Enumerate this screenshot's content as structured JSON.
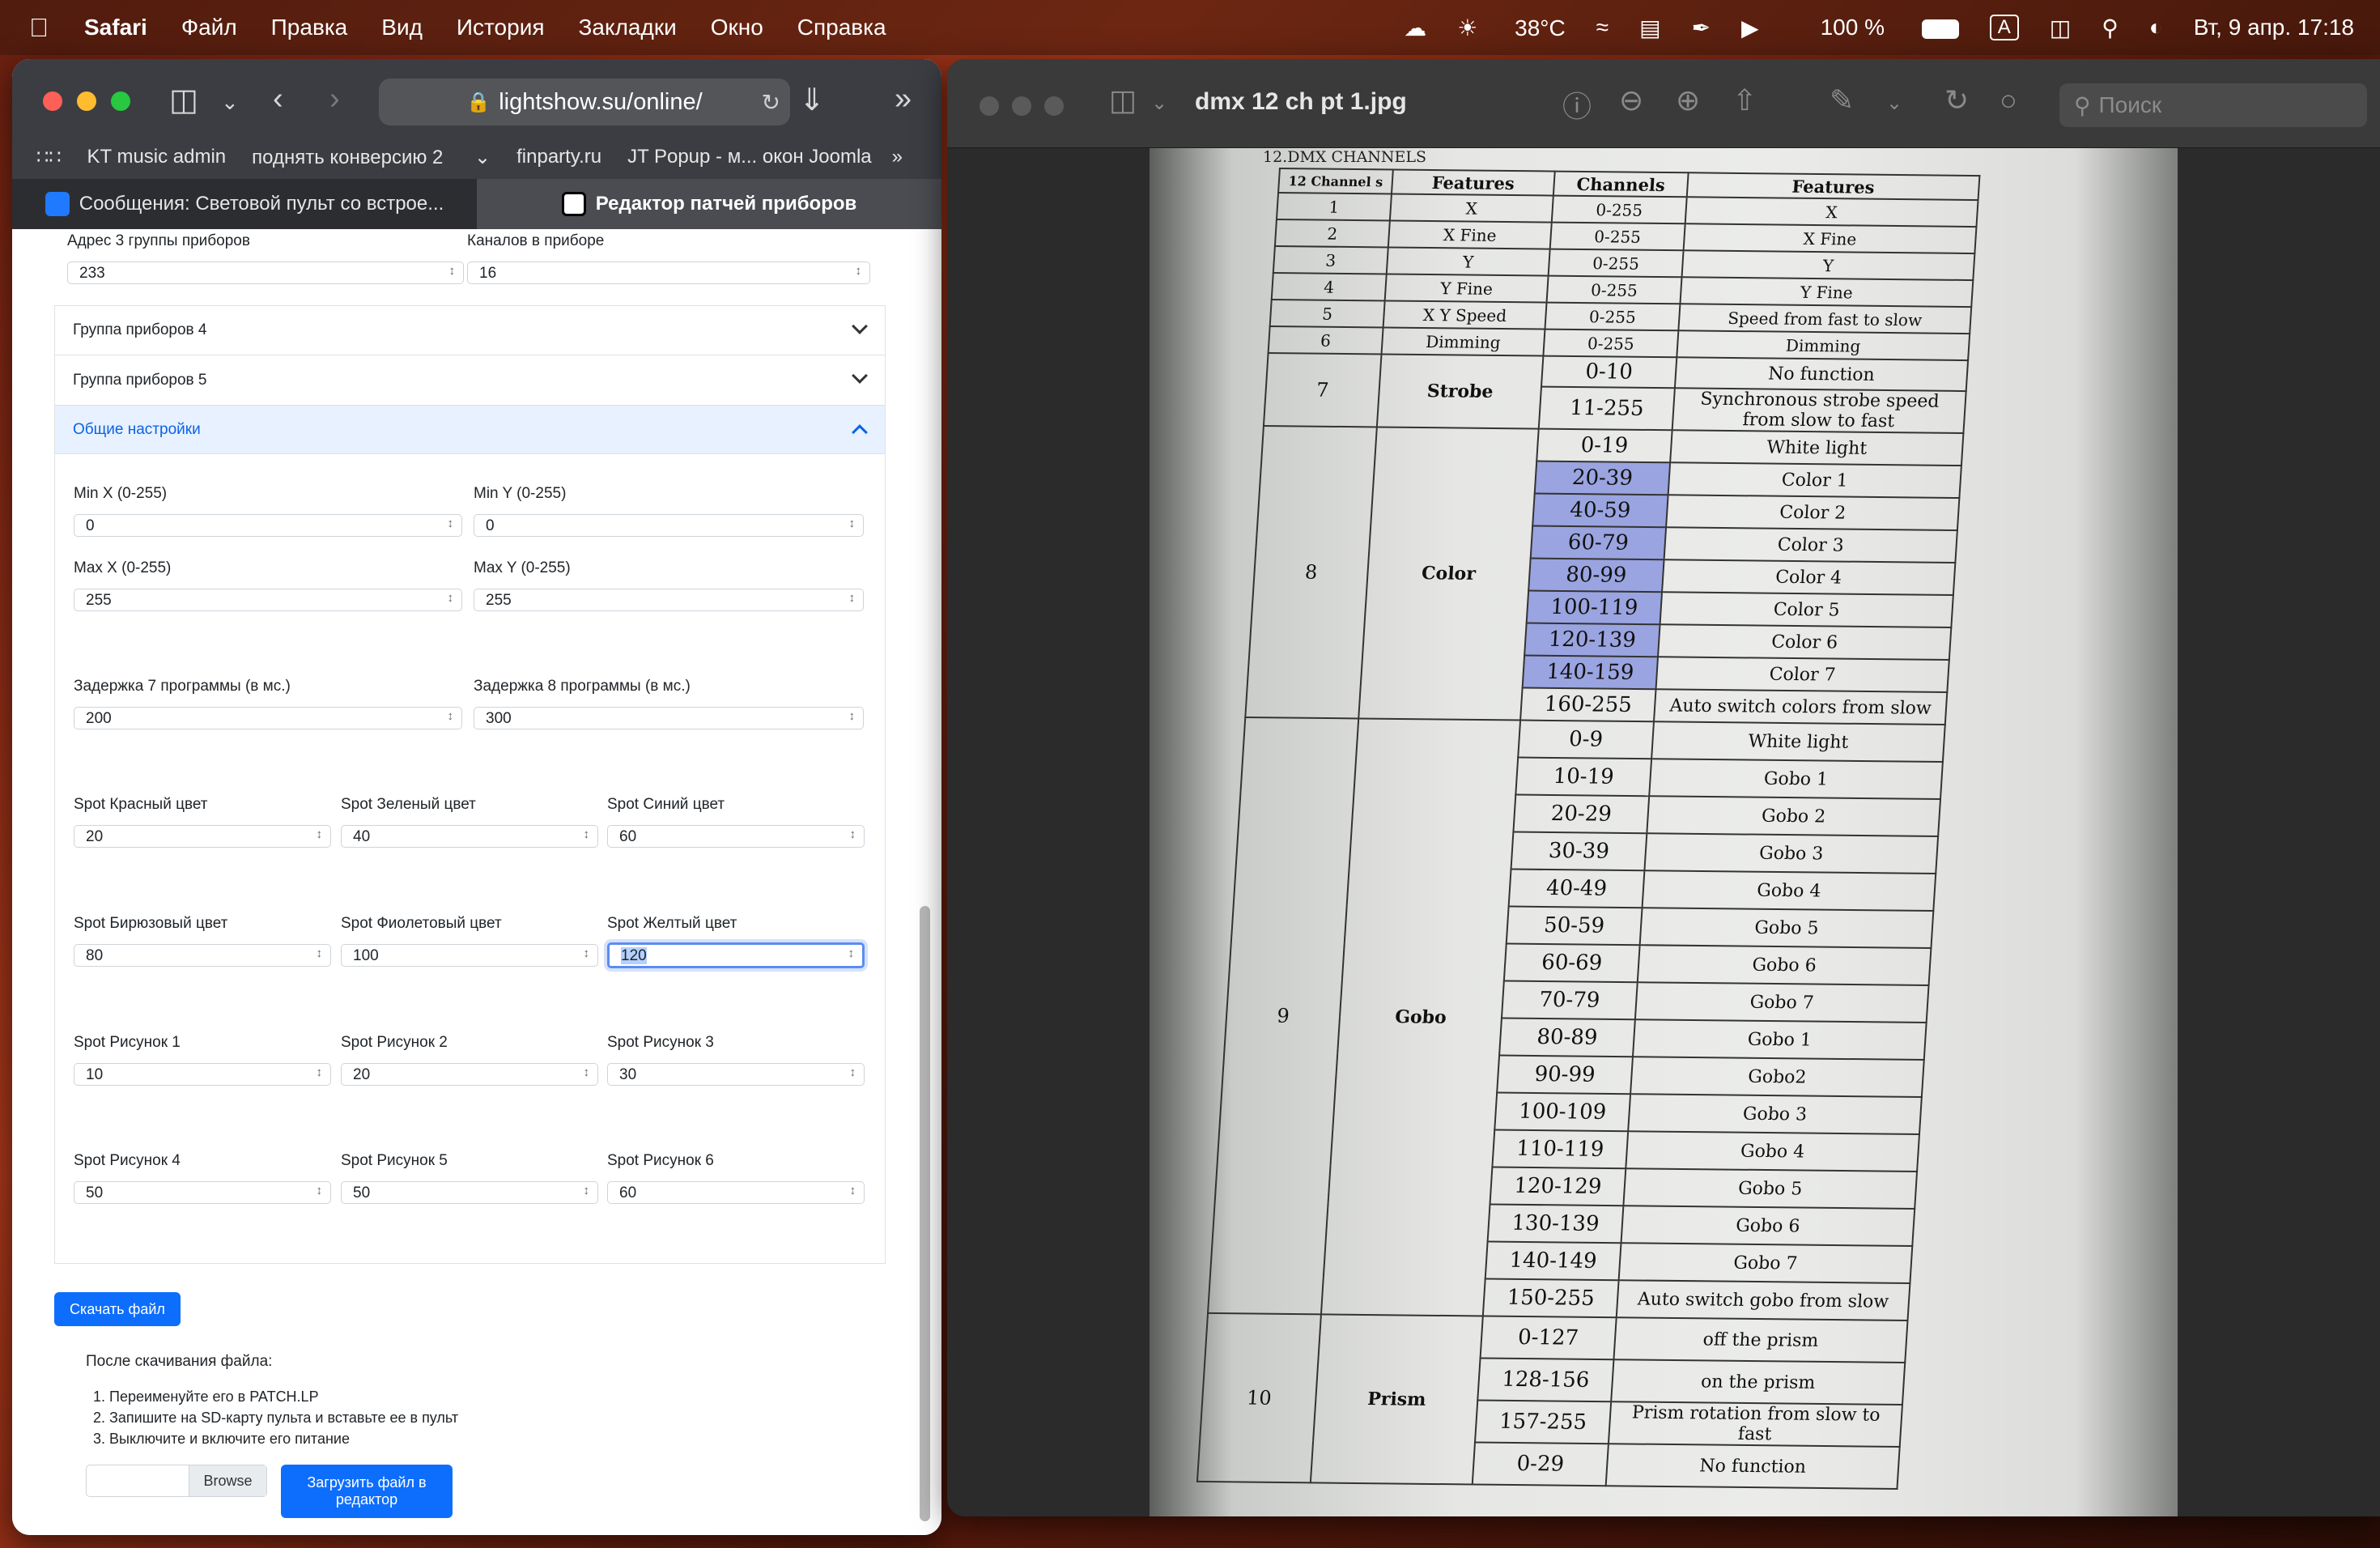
{
  "menubar": {
    "app": "Safari",
    "items": [
      "Файл",
      "Правка",
      "Вид",
      "История",
      "Закладки",
      "Окно",
      "Справка"
    ],
    "temperature": "38°C",
    "battery": "100 %",
    "input_lang": "A",
    "datetime": "Вт, 9 апр.  17:18"
  },
  "safari": {
    "url": "lightshow.su/online/",
    "bookmarks": [
      "KT music admin",
      "поднять конверсию 2",
      "finparty.ru",
      "JT Popup - м... окон Joomla"
    ],
    "tabs": [
      {
        "label": "Сообщения: Световой пульт со встрое...",
        "active": false
      },
      {
        "label": "Редактор патчей приборов",
        "active": true
      }
    ]
  },
  "form": {
    "group3_address_label": "Адрес 3 группы приборов",
    "group3_address": "233",
    "channels_label": "Каналов в приборе",
    "channels": "16",
    "group4": "Группа приборов 4",
    "group5": "Группа приборов 5",
    "general": "Общие настройки",
    "min_x_label": "Min X (0-255)",
    "min_x": "0",
    "min_y_label": "Min Y (0-255)",
    "min_y": "0",
    "max_x_label": "Max X (0-255)",
    "max_x": "255",
    "max_y_label": "Max Y (0-255)",
    "max_y": "255",
    "delay7_label": "Задержка 7 программы (в мс.)",
    "delay7": "200",
    "delay8_label": "Задержка 8 программы (в мс.)",
    "delay8": "300",
    "spot_colors": [
      {
        "label": "Spot Красный цвет",
        "value": "20"
      },
      {
        "label": "Spot Зеленый цвет",
        "value": "40"
      },
      {
        "label": "Spot Синий цвет",
        "value": "60"
      },
      {
        "label": "Spot Бирюзовый цвет",
        "value": "80"
      },
      {
        "label": "Spot Фиолетовый цвет",
        "value": "100"
      },
      {
        "label": "Spot Желтый цвет",
        "value": "120"
      }
    ],
    "spot_gobos": [
      {
        "label": "Spot Рисунок 1",
        "value": "10"
      },
      {
        "label": "Spot Рисунок 2",
        "value": "20"
      },
      {
        "label": "Spot Рисунок 3",
        "value": "30"
      },
      {
        "label": "Spot Рисунок 4",
        "value": "50"
      },
      {
        "label": "Spot Рисунок 5",
        "value": "50"
      },
      {
        "label": "Spot Рисунок 6",
        "value": "60"
      }
    ],
    "download_button": "Скачать файл",
    "after_download": "После скачивания файла:",
    "steps": [
      "1.  Переименуйте его в PATCH.LP",
      "2.  Запишите на SD-карту пульта и вставьте ее в пульт",
      "3.  Выключите и включите его питание"
    ],
    "browse": "Browse",
    "upload_button": "Загрузить файл в редактор"
  },
  "preview": {
    "title": "dmx 12 ch pt 1.jpg",
    "search_placeholder": "Поиск",
    "doc_title": "12.DMX CHANNELS",
    "headers": [
      "12 Channel s",
      "Features",
      "Channels",
      "Features"
    ],
    "rows": [
      {
        "ch": "1",
        "feat": "X",
        "val": "0-255",
        "desc": "X"
      },
      {
        "ch": "2",
        "feat": "X Fine",
        "val": "0-255",
        "desc": "X Fine"
      },
      {
        "ch": "3",
        "feat": "Y",
        "val": "0-255",
        "desc": "Y"
      },
      {
        "ch": "4",
        "feat": "Y  Fine",
        "val": "0-255",
        "desc": "Y Fine"
      },
      {
        "ch": "5",
        "feat": "X Y Speed",
        "val": "0-255",
        "desc": "Speed from fast to slow"
      },
      {
        "ch": "6",
        "feat": "Dimming",
        "val": "0-255",
        "desc": "Dimming"
      }
    ],
    "strobe": {
      "ch": "7",
      "feat": "Strobe",
      "rows": [
        {
          "val": "0-10",
          "desc": "No function"
        },
        {
          "val": "11-255",
          "desc": "Synchronous strobe speed from slow to fast"
        }
      ]
    },
    "color": {
      "ch": "8",
      "feat": "Color",
      "rows": [
        {
          "val": "0-19",
          "desc": "White light",
          "hl": false
        },
        {
          "val": "20-39",
          "desc": "Color 1",
          "hl": true
        },
        {
          "val": "40-59",
          "desc": "Color 2",
          "hl": true
        },
        {
          "val": "60-79",
          "desc": "Color 3",
          "hl": true
        },
        {
          "val": "80-99",
          "desc": "Color 4",
          "hl": true
        },
        {
          "val": "100-119",
          "desc": "Color 5",
          "hl": true
        },
        {
          "val": "120-139",
          "desc": "Color 6",
          "hl": true
        },
        {
          "val": "140-159",
          "desc": "Color 7",
          "hl": true
        },
        {
          "val": "160-255",
          "desc": "Auto switch colors   from slow",
          "hl": false
        }
      ]
    },
    "gobo": {
      "ch": "9",
      "feat": "Gobo",
      "rows": [
        {
          "val": "0-9",
          "desc": "White light"
        },
        {
          "val": "10-19",
          "desc": "Gobo 1"
        },
        {
          "val": "20-29",
          "desc": "Gobo 2"
        },
        {
          "val": "30-39",
          "desc": "Gobo 3"
        },
        {
          "val": "40-49",
          "desc": "Gobo 4"
        },
        {
          "val": "50-59",
          "desc": "Gobo 5"
        },
        {
          "val": "60-69",
          "desc": "Gobo 6"
        },
        {
          "val": "70-79",
          "desc": "Gobo 7"
        },
        {
          "val": "80-89",
          "desc": "Gobo 1"
        },
        {
          "val": "90-99",
          "desc": "Gobo2"
        },
        {
          "val": "100-109",
          "desc": "Gobo 3"
        },
        {
          "val": "110-119",
          "desc": "Gobo 4"
        },
        {
          "val": "120-129",
          "desc": "Gobo 5"
        },
        {
          "val": "130-139",
          "desc": "Gobo 6"
        },
        {
          "val": "140-149",
          "desc": "Gobo 7"
        },
        {
          "val": "150-255",
          "desc": "Auto switch   gobo   from slow"
        }
      ]
    },
    "prism": {
      "ch": "10",
      "feat": "Prism",
      "rows": [
        {
          "val": "0-127",
          "desc": "off  the prism"
        },
        {
          "val": "128-156",
          "desc": "on  the prism"
        },
        {
          "val": "157-255",
          "desc": "Prism rotation from slow to fast"
        },
        {
          "val": "0-29",
          "desc": "No function"
        }
      ]
    }
  }
}
